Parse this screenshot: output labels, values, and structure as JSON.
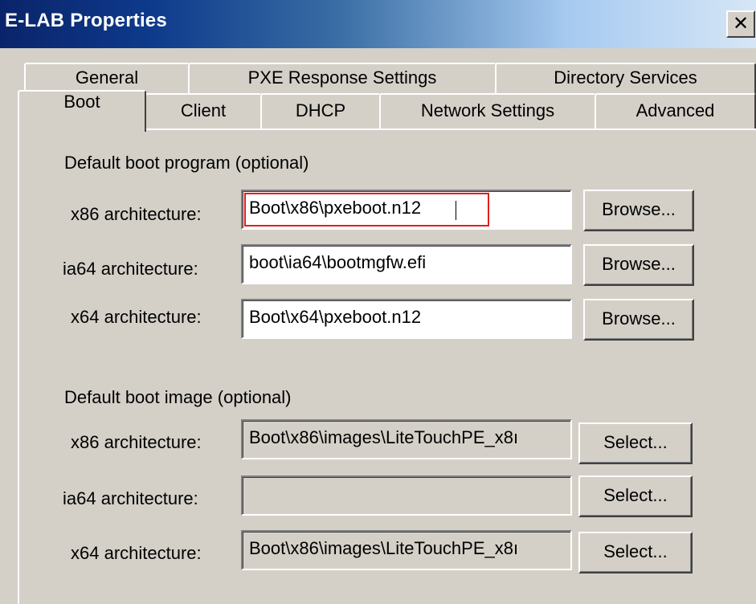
{
  "window": {
    "title": "E-LAB Properties",
    "close_glyph": "✕"
  },
  "tabs": {
    "row1": [
      {
        "label": "General"
      },
      {
        "label": "PXE Response Settings"
      },
      {
        "label": "Directory Services"
      }
    ],
    "row2": [
      {
        "label": "Boot",
        "active": true
      },
      {
        "label": "Client"
      },
      {
        "label": "DHCP"
      },
      {
        "label": "Network Settings"
      },
      {
        "label": "Advanced"
      }
    ]
  },
  "boot_program": {
    "legend": "Default boot program (optional)",
    "rows": [
      {
        "label": "x86 architecture:",
        "value": "Boot\\x86\\pxeboot.n12",
        "button": "Browse..."
      },
      {
        "label": "ia64 architecture:",
        "value": "boot\\ia64\\bootmgfw.efi",
        "button": "Browse..."
      },
      {
        "label": "x64 architecture:",
        "value": "Boot\\x64\\pxeboot.n12",
        "button": "Browse..."
      }
    ]
  },
  "boot_image": {
    "legend": "Default boot image (optional)",
    "rows": [
      {
        "label": "x86 architecture:",
        "value": "Boot\\x86\\images\\LiteTouchPE_x8ı",
        "button": "Select..."
      },
      {
        "label": "ia64 architecture:",
        "value": "",
        "button": "Select..."
      },
      {
        "label": "x64 architecture:",
        "value": "Boot\\x86\\images\\LiteTouchPE_x8ı",
        "button": "Select..."
      }
    ]
  },
  "colors": {
    "dialog_face": "#d4d0c8",
    "title_bar_start": "#0a246a",
    "highlight_border": "#e0201c"
  }
}
